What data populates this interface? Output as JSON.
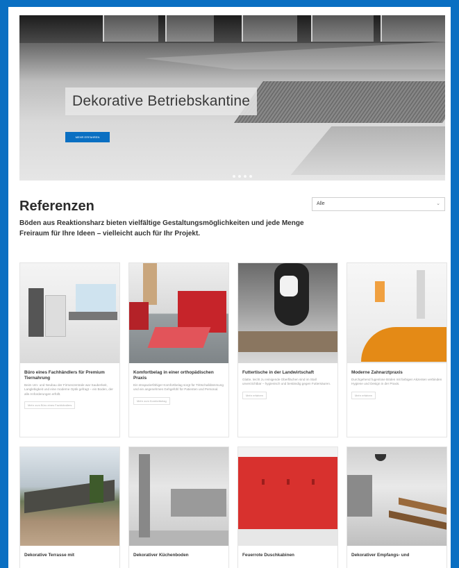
{
  "hero": {
    "title": "Dekorative Betriebskantine",
    "button_label": "MEHR ERFAHREN",
    "slide_count": 4
  },
  "references": {
    "heading": "Referenzen",
    "description": "Böden aus Reaktionsharz bieten vielfältige Gestaltungsmöglichkeiten und jede Menge Freiraum für Ihre Ideen – vielleicht auch für Ihr Projekt.",
    "filter_value": "Alle",
    "filter_chevron": "⌄"
  },
  "cards": [
    {
      "title": "Büro eines Fachhändlers für Premium Tiernahrung",
      "text": "Beim Um- und Neubau der Firmenzentrale war Sauberkeit, Langlebigkeit und eine moderne Optik gefragt – ein Boden, der alle Anforderungen erfüllt.",
      "more_label": "Mehr zum Büro eines Fachhändlers"
    },
    {
      "title": "Komfortbelag in einer orthopädischen Praxis",
      "text": "Ein strapazierfähiger Komfortbelag sorgt für Trittschalldämmung und ein angenehmes Gehgefühl für Patienten und Personal.",
      "more_label": "Mehr zum Komfortbelag"
    },
    {
      "title": "Futtertische in der Landwirtschaft",
      "text": "Glatte, leicht zu reinigende Oberflächen sind im Stall unverzichtbar – hygienisch und beständig gegen Futtersäuren.",
      "more_label": "Mehr erfahren"
    },
    {
      "title": "Moderne Zahnarztpraxis",
      "text": "Durchgehend fugenlose Böden mit farbigen Akzenten verbinden Hygiene und Design in der Praxis.",
      "more_label": "Mehr erfahren"
    },
    {
      "title": "Dekorative Terrasse mit"
    },
    {
      "title": "Dekorativer Küchenboden"
    },
    {
      "title": "Feuerrote Duschkabinen"
    },
    {
      "title": "Dekorativer Empfangs- und"
    }
  ],
  "colors": {
    "brand_blue": "#0a6fc2",
    "accent_red": "#d8312e",
    "accent_orange": "#e48a16"
  }
}
